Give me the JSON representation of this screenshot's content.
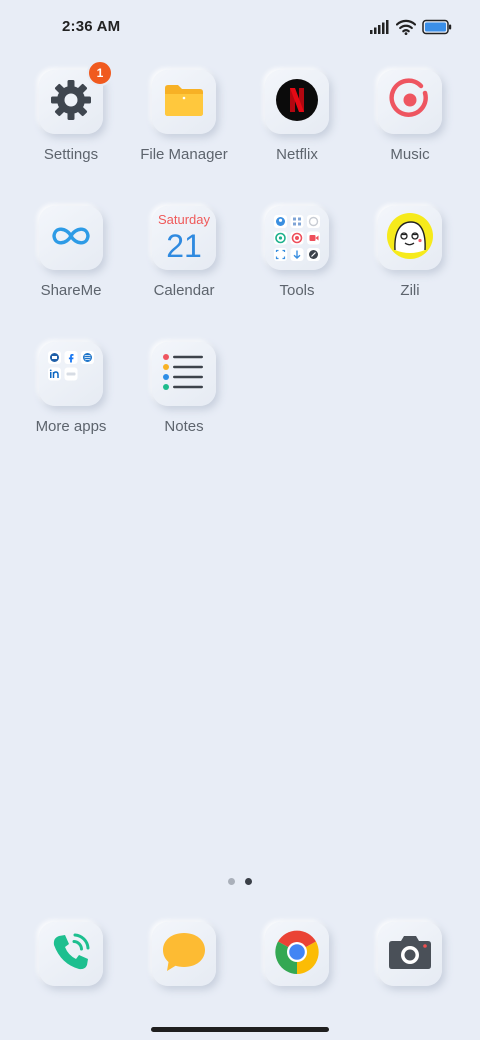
{
  "status_bar": {
    "time": "2:36 AM",
    "icons": [
      "signal-icon",
      "wifi-icon",
      "battery-icon"
    ]
  },
  "apps": {
    "settings": {
      "label": "Settings",
      "badge": "1",
      "icon": "gear-icon"
    },
    "file_manager": {
      "label": "File Manager",
      "icon": "folder-icon"
    },
    "netflix": {
      "label": "Netflix",
      "icon": "netflix-icon"
    },
    "music": {
      "label": "Music",
      "icon": "music-icon"
    },
    "shareme": {
      "label": "ShareMe",
      "icon": "infinity-icon"
    },
    "calendar": {
      "label": "Calendar",
      "day": "Saturday",
      "date": "21",
      "icon": "calendar-icon"
    },
    "tools": {
      "label": "Tools",
      "icon": "tools-folder-icon"
    },
    "zili": {
      "label": "Zili",
      "icon": "zili-icon"
    },
    "more_apps": {
      "label": "More apps",
      "icon": "app-folder-icon"
    },
    "notes": {
      "label": "Notes",
      "icon": "notes-icon"
    }
  },
  "dock": {
    "phone": {
      "icon": "phone-icon"
    },
    "messages": {
      "icon": "message-icon"
    },
    "chrome": {
      "icon": "chrome-icon"
    },
    "camera": {
      "icon": "camera-icon"
    }
  },
  "page_indicator": {
    "pages": 2,
    "active_page": 2
  },
  "colors": {
    "background": "#e8edf6",
    "badge": "#f05a1f",
    "calendar_day": "#ef5a5a",
    "calendar_date": "#2f8ae0"
  }
}
